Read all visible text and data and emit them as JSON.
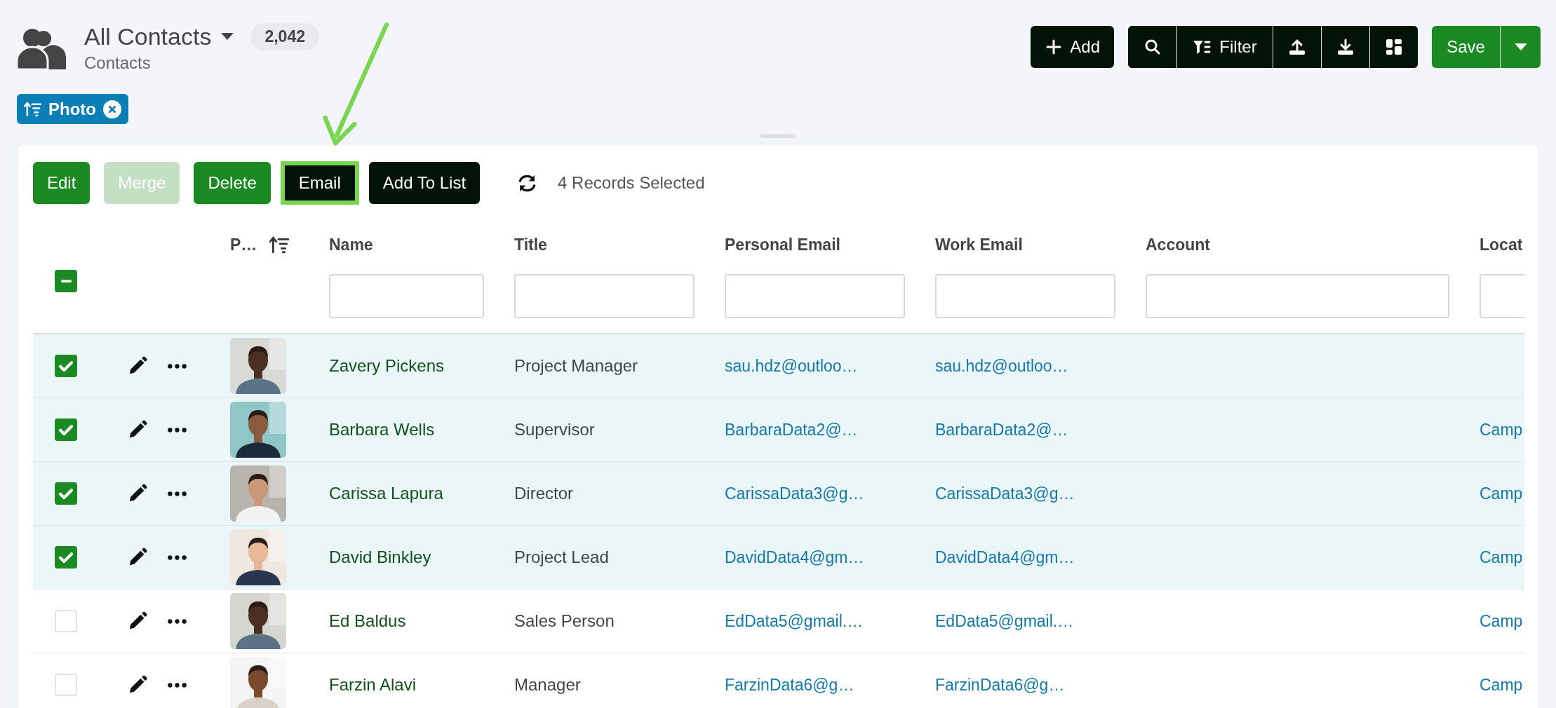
{
  "header": {
    "title": "All Contacts",
    "count": "2,042",
    "subtitle": "Contacts"
  },
  "sort_chip": {
    "label": "Photo"
  },
  "add_button": {
    "label": "Add"
  },
  "tools": [
    {
      "kind": "search"
    },
    {
      "kind": "filter",
      "label": "Filter"
    },
    {
      "kind": "upload"
    },
    {
      "kind": "download"
    },
    {
      "kind": "layout"
    }
  ],
  "save_button": {
    "label": "Save"
  },
  "actions": [
    {
      "label": "Edit",
      "kind": "primary",
      "disabled": false,
      "highlighted": false
    },
    {
      "label": "Merge",
      "kind": "primary",
      "disabled": true,
      "highlighted": false
    },
    {
      "label": "Delete",
      "kind": "primary",
      "disabled": false,
      "highlighted": false
    },
    {
      "label": "Email",
      "kind": "secondary",
      "disabled": false,
      "highlighted": true
    },
    {
      "label": "Add To List",
      "kind": "secondary",
      "disabled": false,
      "highlighted": false
    }
  ],
  "selection_text": "4 Records Selected",
  "select_all": {
    "indeterminate": true
  },
  "columns": [
    {
      "label": "P…",
      "sorted": true,
      "filter": false
    },
    {
      "label": "Name",
      "sorted": false,
      "filter": true
    },
    {
      "label": "Title",
      "sorted": false,
      "filter": true
    },
    {
      "label": "Personal Email",
      "sorted": false,
      "filter": true
    },
    {
      "label": "Work Email",
      "sorted": false,
      "filter": true
    },
    {
      "label": "Account",
      "sorted": false,
      "filter": true
    },
    {
      "label": "Locat",
      "sorted": false,
      "filter": true
    }
  ],
  "rows": [
    {
      "selected": true,
      "name": "Zavery Pickens",
      "title": "Project Manager",
      "personal_email": "sau.hdz@outloo…",
      "work_email": "sau.hdz@outloo…"
    },
    {
      "selected": true,
      "name": "Barbara Wells",
      "title": "Supervisor",
      "personal_email": "BarbaraData2@…",
      "work_email": "BarbaraData2@…",
      "location": "Camp"
    },
    {
      "selected": true,
      "name": "Carissa Lapura",
      "title": "Director",
      "personal_email": "CarissaData3@g…",
      "work_email": "CarissaData3@g…",
      "location": "Camp"
    },
    {
      "selected": true,
      "name": "David Binkley",
      "title": "Project Lead",
      "personal_email": "DavidData4@gm…",
      "work_email": "DavidData4@gm…",
      "location": "Camp"
    },
    {
      "selected": false,
      "name": "Ed Baldus",
      "title": "Sales Person",
      "personal_email": "EdData5@gmail.…",
      "work_email": "EdData5@gmail.…",
      "location": "Camp"
    },
    {
      "selected": false,
      "name": "Farzin Alavi",
      "title": "Manager",
      "personal_email": "FarzinData6@g…",
      "work_email": "FarzinData6@g…",
      "location": "Camp"
    }
  ]
}
